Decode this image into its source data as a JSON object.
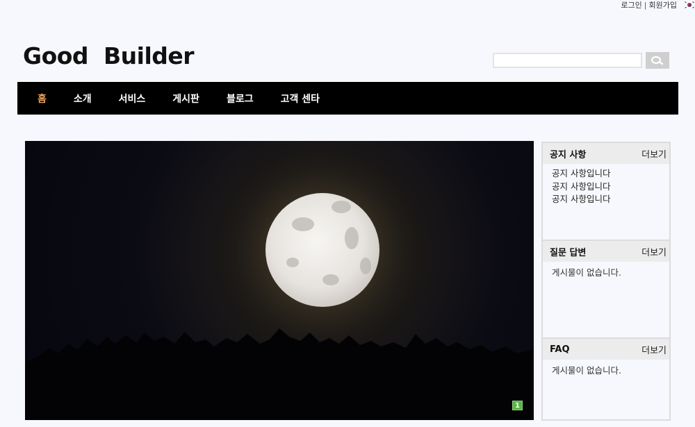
{
  "utility": {
    "login": "로그인",
    "separator": "|",
    "signup": "회원가입"
  },
  "logo": {
    "text": "Good  Builder"
  },
  "search": {
    "placeholder": "",
    "value": "",
    "icon": "search-icon"
  },
  "nav": {
    "items": [
      {
        "label": "홈",
        "active": true
      },
      {
        "label": "소개"
      },
      {
        "label": "서비스"
      },
      {
        "label": "게시판"
      },
      {
        "label": "블로그"
      },
      {
        "label": "고객 센타"
      }
    ],
    "active_color": "#f0a25b"
  },
  "hero": {
    "image": "full-moon-over-forest",
    "slide_number": "1"
  },
  "sidebar": {
    "notice": {
      "title": "공지 사항",
      "more": "더보기",
      "items": [
        "공지 사항입니다",
        "공지 사항입니다",
        "공지 사항입니다"
      ]
    },
    "qna": {
      "title": "질문 답변",
      "more": "더보기",
      "empty": "게시물이 없습니다."
    },
    "faq": {
      "title": "FAQ",
      "more": "더보기",
      "empty": "게시물이 없습니다."
    }
  }
}
